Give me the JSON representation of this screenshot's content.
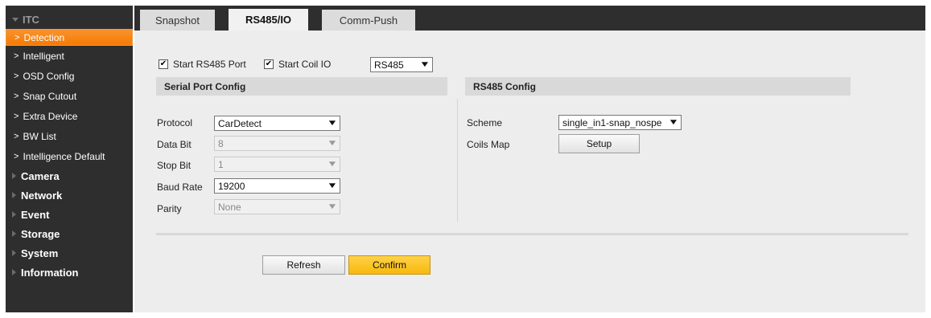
{
  "sidebar": {
    "open_group": "ITC",
    "items": [
      {
        "label": "Detection"
      },
      {
        "label": "Intelligent"
      },
      {
        "label": "OSD Config"
      },
      {
        "label": "Snap Cutout"
      },
      {
        "label": "Extra Device"
      },
      {
        "label": "BW List"
      },
      {
        "label": "Intelligence Default"
      }
    ],
    "groups": [
      "Camera",
      "Network",
      "Event",
      "Storage",
      "System",
      "Information"
    ]
  },
  "tabs": [
    "Snapshot",
    "RS485/IO",
    "Comm-Push"
  ],
  "options": {
    "start_rs485_label": "Start RS485 Port",
    "start_rs485_checked": true,
    "start_coil_label": "Start Coil IO",
    "start_coil_checked": true,
    "port_select": "RS485"
  },
  "serial": {
    "title": "Serial Port Config",
    "protocol_label": "Protocol",
    "protocol_value": "CarDetect",
    "databit_label": "Data Bit",
    "databit_value": "8",
    "stopbit_label": "Stop Bit",
    "stopbit_value": "1",
    "baud_label": "Baud Rate",
    "baud_value": "19200",
    "parity_label": "Parity",
    "parity_value": "None"
  },
  "rs485": {
    "title": "RS485 Config",
    "scheme_label": "Scheme",
    "scheme_value": "single_in1-snap_nospe",
    "coils_label": "Coils Map",
    "setup_button": "Setup"
  },
  "buttons": {
    "refresh": "Refresh",
    "confirm": "Confirm"
  },
  "colors": {
    "sidebar_bg": "#2e2e2e",
    "active_item": "#f7810d",
    "confirm": "#ffc31e"
  }
}
